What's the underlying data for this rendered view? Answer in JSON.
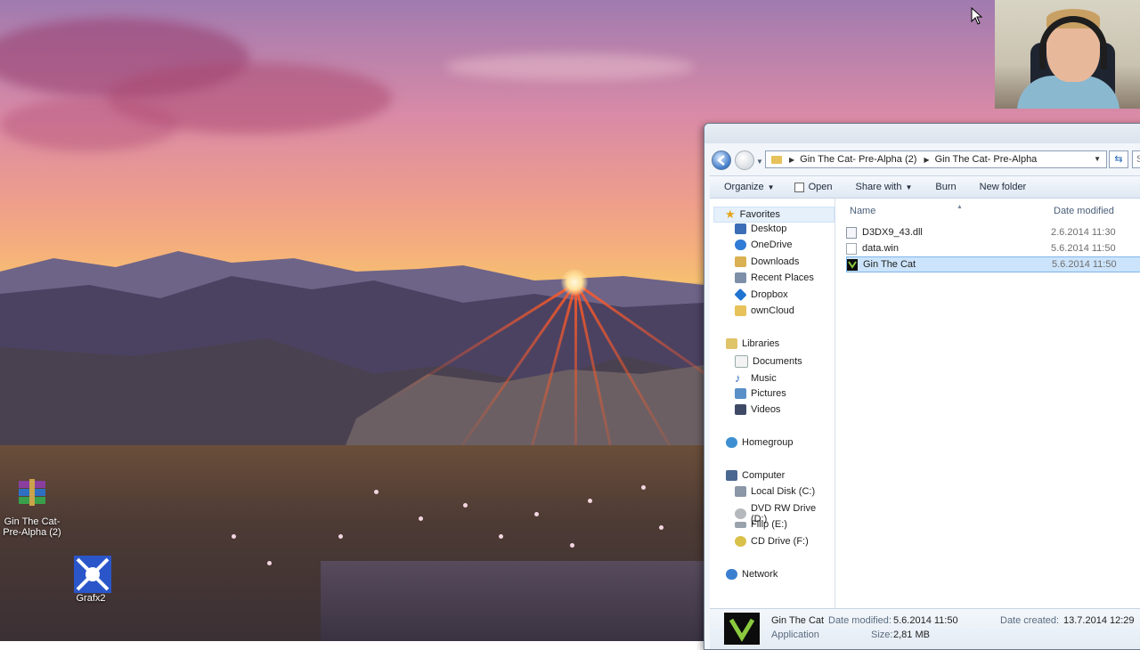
{
  "desktop": {
    "icons": [
      {
        "label_line1": "Gin The Cat-",
        "label_line2": "Pre-Alpha (2)",
        "icon": "winrar-archive-icon"
      },
      {
        "label_line1": "Grafx2",
        "icon": "grafx2-app-icon"
      }
    ]
  },
  "explorer": {
    "address": {
      "segments": [
        "Gin The Cat- Pre-Alpha (2)",
        "Gin The Cat- Pre-Alpha"
      ],
      "search_placeholder": "S"
    },
    "toolbar": {
      "organize": "Organize",
      "open": "Open",
      "share_with": "Share with",
      "burn": "Burn",
      "new_folder": "New folder"
    },
    "nav": {
      "favorites": {
        "label": "Favorites",
        "items": [
          "Desktop",
          "OneDrive",
          "Downloads",
          "Recent Places",
          "Dropbox",
          "ownCloud"
        ]
      },
      "libraries": {
        "label": "Libraries",
        "items": [
          "Documents",
          "Music",
          "Pictures",
          "Videos"
        ]
      },
      "homegroup": {
        "label": "Homegroup"
      },
      "computer": {
        "label": "Computer",
        "items": [
          "Local Disk (C:)",
          "DVD RW Drive (D:)",
          "Filip (E:)",
          "CD Drive (F:)"
        ]
      },
      "network": {
        "label": "Network"
      }
    },
    "columns": {
      "name": "Name",
      "date_modified": "Date modified"
    },
    "files": [
      {
        "name": "D3DX9_43.dll",
        "date": "2.6.2014 11:30",
        "icon": "dll-file-icon"
      },
      {
        "name": "data.win",
        "date": "5.6.2014 11:50",
        "icon": "blank-file-icon"
      },
      {
        "name": "Gin The Cat",
        "date": "5.6.2014 11:50",
        "icon": "gamemaker-app-icon",
        "selected": true
      }
    ],
    "details": {
      "name": "Gin The Cat",
      "type": "Application",
      "date_modified_label": "Date modified:",
      "date_modified": "5.6.2014 11:50",
      "size_label": "Size:",
      "size": "2,81 MB",
      "date_created_label": "Date created:",
      "date_created": "13.7.2014 12:29"
    }
  }
}
